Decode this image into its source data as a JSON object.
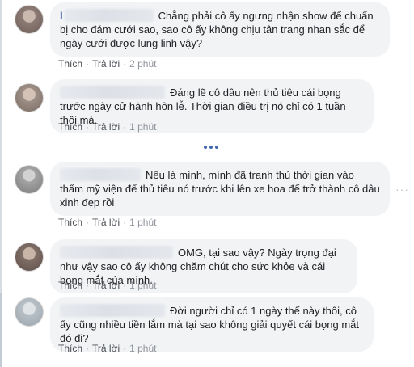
{
  "comments": [
    {
      "name_initial": "l",
      "text": "Chẳng phải cô ấy ngưng nhận show để chuẩn bị cho đám cưới sao, sao cô ấy không chịu tân trang nhan sắc để ngày cưới được lung linh vậy?",
      "like": "Thích",
      "reply": "Trả lời",
      "time": "2 phút",
      "avatar_color": "#8c7b74"
    },
    {
      "name_initial": "",
      "text": "Đáng lẽ cô dâu nên thủ tiêu cái bọng trước ngày cử hành hôn lễ. Thời gian điều trị nó chỉ có 1 tuần thôi mà.",
      "like": "Thích",
      "reply": "Trả lời",
      "time": "1 phút",
      "avatar_color": "#9e8f86"
    },
    {
      "name_initial": "",
      "text": "Nếu là mình, mình đã tranh thủ thời gian vào thẩm mỹ viện để thủ tiêu nó trước khi lên xe hoa để trở thành cô dâu xinh đẹp rồi",
      "like": "Thích",
      "reply": "Trả lời",
      "time": "1 phút",
      "avatar_color": "#a3a3a3"
    },
    {
      "name_initial": "",
      "text": "OMG, tại sao vậy? Ngày trọng đại như vậy sao cô ấy không chăm chút cho sức khỏe và cái bọng mắt của mình.",
      "like": "Thích",
      "reply": "Trả lời",
      "time": "1 phút",
      "avatar_color": "#7f6e66"
    },
    {
      "name_initial": "",
      "text": "Đời người chỉ có 1 ngày thế này thôi, cô ấy cũng nhiều tiền lắm mà tại sao không giải quyết cái bọng mắt đó đi?",
      "like": "Thích",
      "reply": "Trả lời",
      "time": "1 phút",
      "avatar_color": "#b8c0c7"
    }
  ],
  "more_replies_icon": "more-dots-icon",
  "comment_options_icon": "ellipsis-icon"
}
